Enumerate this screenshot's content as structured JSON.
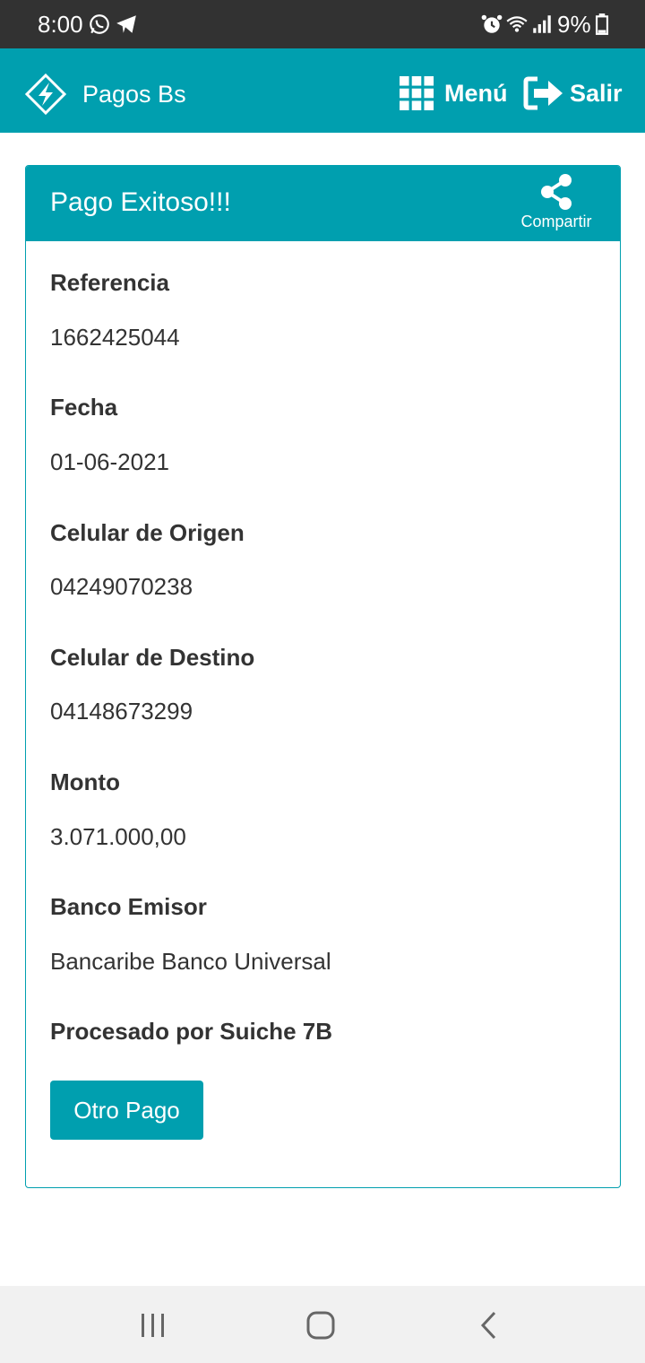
{
  "status_bar": {
    "time": "8:00",
    "battery": "9%",
    "icons": [
      "whatsapp-icon",
      "telegram-icon",
      "alarm-icon",
      "wifi-icon",
      "signal-icon",
      "battery-icon"
    ]
  },
  "app_bar": {
    "title": "Pagos Bs",
    "menu_label": "Menú",
    "exit_label": "Salir"
  },
  "card": {
    "title": "Pago Exitoso!!!",
    "share_label": "Compartir",
    "fields": [
      {
        "label": "Referencia",
        "value": "1662425044"
      },
      {
        "label": "Fecha",
        "value": "01-06-2021"
      },
      {
        "label": "Celular de Origen",
        "value": "04249070238"
      },
      {
        "label": "Celular de Destino",
        "value": "04148673299"
      },
      {
        "label": "Monto",
        "value": "3.071.000,00"
      },
      {
        "label": "Banco Emisor",
        "value": "Bancaribe Banco Universal"
      }
    ],
    "processed_by": "Procesado por Suiche 7B",
    "button_label": "Otro Pago"
  },
  "colors": {
    "primary": "#009faf",
    "status_bar": "#323232",
    "text": "#333333",
    "nav_bar": "#f1f1f1"
  }
}
